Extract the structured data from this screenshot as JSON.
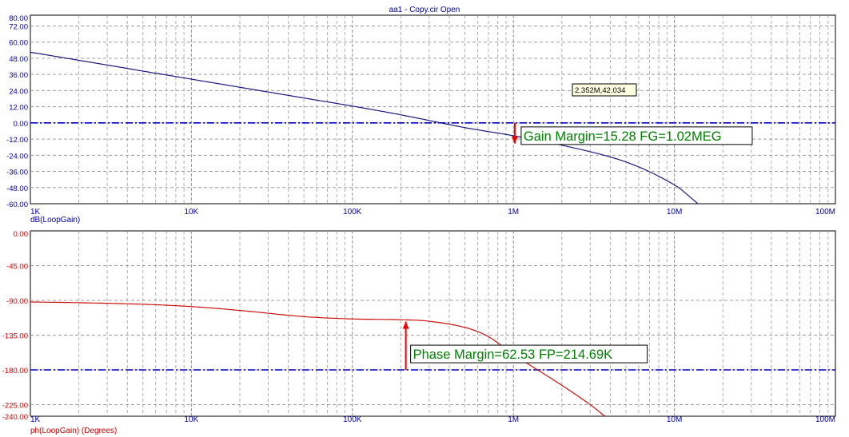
{
  "window_title": "aa1 - Copy.cir Open",
  "colors": {
    "gain_curve": "#1a1a80",
    "phase_curve": "#cc1010",
    "reference_line": "#0000c0",
    "axis_text_blue": "#0000aa",
    "axis_text_red": "#cc0000",
    "annotation_text": "#008000",
    "marker_arrow": "#ee0000",
    "grid": "#8c8c8c"
  },
  "chart_data": [
    {
      "type": "line",
      "name": "gain-plot",
      "title": "",
      "xlabel": "",
      "ylabel": "dB(LoopGain)",
      "xscale": "log",
      "xlim": [
        1000,
        100000000
      ],
      "ylim": [
        -60,
        80
      ],
      "x_tick_labels": [
        "1K",
        "10K",
        "100K",
        "1M",
        "10M",
        "100M"
      ],
      "y_tick_labels": [
        "80.00",
        "72.00",
        "60.00",
        "48.00",
        "36.00",
        "24.00",
        "12.00",
        "0.00",
        "-12.00",
        "-24.00",
        "-36.00",
        "-48.00",
        "-60.00"
      ],
      "y_tick_values": [
        80,
        72,
        60,
        48,
        36,
        24,
        12,
        0,
        -12,
        -24,
        -36,
        -48,
        -60
      ],
      "reference_line_y": 0,
      "grid": true,
      "series": [
        {
          "x": [
            1000,
            2000,
            5000,
            10000,
            20000,
            50000,
            100000,
            200000,
            500000,
            1000000,
            2000000,
            5000000,
            10000000,
            14000000
          ],
          "y": [
            52.5,
            46.5,
            38.5,
            32.5,
            26.5,
            18.5,
            12.5,
            6.0,
            -3.5,
            -9.5,
            -16.5,
            -29.0,
            -46.0,
            -60.0
          ]
        }
      ],
      "annotations": [
        {
          "text": "Gain Margin=15.28 FG=1.02MEG",
          "x": 1020000,
          "y_from": 0,
          "y_to": -15.28
        },
        {
          "text": "2.352M,42.034"
        }
      ]
    },
    {
      "type": "line",
      "name": "phase-plot",
      "title": "",
      "xlabel": "",
      "ylabel": "ph(LoopGain) (Degrees)",
      "xscale": "log",
      "xlim": [
        1000,
        100000000
      ],
      "ylim": [
        -240,
        0
      ],
      "x_tick_labels": [
        "1K",
        "10K",
        "100K",
        "1M",
        "10M",
        "100M"
      ],
      "y_tick_labels": [
        "0.00",
        "-45.00",
        "-90.00",
        "-135.00",
        "-180.00",
        "-225.00",
        "-240.00"
      ],
      "y_tick_values": [
        0,
        -45,
        -90,
        -135,
        -180,
        -225,
        -240
      ],
      "reference_line_y": -180,
      "grid": true,
      "series": [
        {
          "x": [
            1000,
            2000,
            5000,
            10000,
            20000,
            50000,
            100000,
            200000,
            300000,
            500000,
            700000,
            1000000,
            2000000,
            3000000,
            3700000
          ],
          "y": [
            -92,
            -93,
            -95,
            -98,
            -103,
            -111,
            -114,
            -115,
            -117,
            -125,
            -137,
            -160,
            -200,
            -225,
            -240
          ]
        }
      ],
      "annotations": [
        {
          "text": "Phase Margin=62.53 FP=214.69K",
          "x": 214690,
          "y_from": -180,
          "y_to": -117.47
        }
      ]
    }
  ]
}
